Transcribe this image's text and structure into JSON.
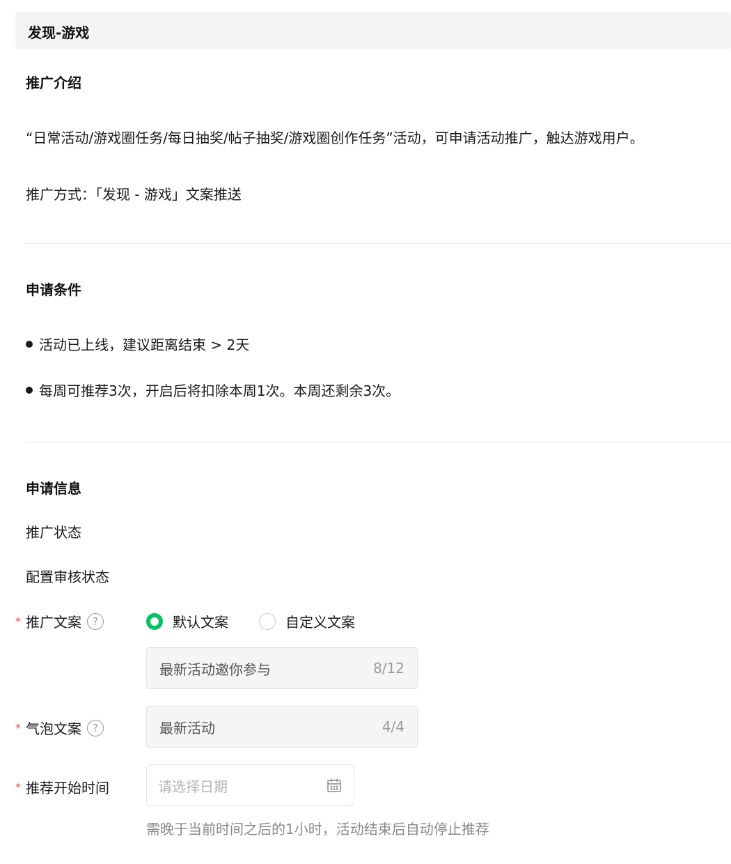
{
  "header": {
    "title": "发现-游戏"
  },
  "intro": {
    "title": "推广介绍",
    "description": "“日常活动/游戏圈任务/每日抽奖/帖子抽奖/游戏圈创作任务”活动，可申请活动推广，触达游戏用户。",
    "method": "推广方式：「发现 - 游戏」文案推送"
  },
  "conditions": {
    "title": "申请条件",
    "items": [
      "活动已上线，建议距离结束 > 2天",
      "每周可推荐3次，开启后将扣除本周1次。本周还剩余3次。"
    ]
  },
  "info": {
    "title": "申请信息",
    "promo_status_label": "推广状态",
    "review_status_label": "配置审核状态",
    "copy_label": "推广文案",
    "copy_options": [
      "默认文案",
      "自定义文案"
    ],
    "copy_selected": "默认文案",
    "copy_value": "最新活动邀你参与",
    "copy_count": "8/12",
    "bubble_label": "气泡文案",
    "bubble_value": "最新活动",
    "bubble_count": "4/4",
    "start_label": "推荐开始时间",
    "date_placeholder": "请选择日期",
    "start_hint": "需晚于当前时间之后的1小时，活动结束后自动停止推荐",
    "required_mark": "*",
    "help_mark": "?"
  },
  "colors": {
    "accent": "#07c160",
    "required": "#e8543f",
    "header_bg": "#f4f4f5"
  },
  "icons": [
    "help-circle-icon",
    "radio-checked-icon",
    "radio-unchecked-icon",
    "calendar-icon"
  ]
}
